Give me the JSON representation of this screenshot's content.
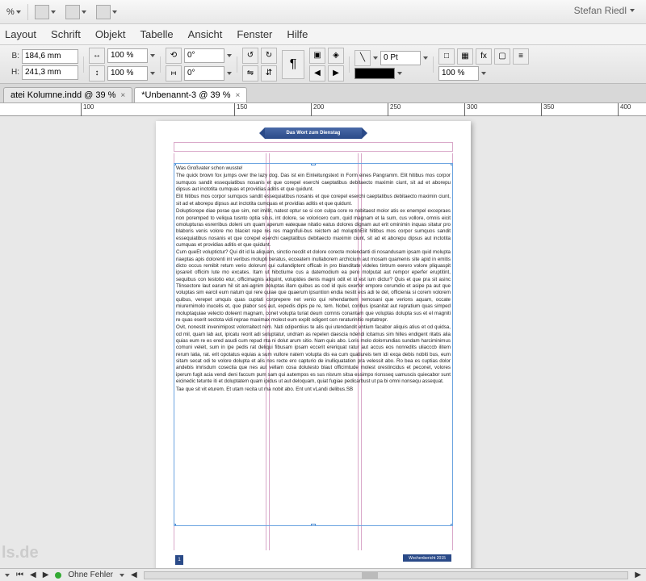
{
  "user": "Stefan Riedl",
  "toolbar1": {
    "zoom_suffix": "%"
  },
  "menu": [
    "Layout",
    "Schrift",
    "Objekt",
    "Tabelle",
    "Ansicht",
    "Fenster",
    "Hilfe"
  ],
  "ctrl": {
    "b_lbl": "B:",
    "b_val": "184,6 mm",
    "h_lbl": "H:",
    "h_val": "241,3 mm",
    "scale1": "100 %",
    "scale2": "100 %",
    "rot1": "0°",
    "rot2": "0°",
    "stroke": "0 Pt",
    "zoom": "100 %"
  },
  "tabs": [
    {
      "label": "atei Kolumne.indd @ 39 %",
      "active": false
    },
    {
      "label": "*Unbenannt-3 @ 39 %",
      "active": true
    }
  ],
  "ruler_ticks": [
    100,
    150,
    200,
    250,
    300
  ],
  "ruler_offsets": [
    100,
    195,
    290,
    385,
    480,
    575,
    670,
    765
  ],
  "page": {
    "header": "Das Wort zum Dienstag",
    "footer": "Wochenbericht 2015",
    "pagenum": "1",
    "title": "Was Großvater schon wusste!",
    "p1": "The quick brown fox jumps over the lazy dog. Das ist ein Einleitungstext in Form eines Pangramm. Elit hitibus mos corpor sumquos sandit essequiatibus nosanis et que corepel eserchi caeptatibus debitaecto maximin ciunt, sit ad et aborepu dipsus aut inctotita cumquas et providias aditis et que quidunt.",
    "p2": "Elit hitibus mos corpor sumquos sandit essequiatibus nosanis et que corepel eserchi caeptatibus debitaecto maximin ciunt, sit ad et aborepu dipsus aut inctotita cumquas et providias aditis et que quidunt.",
    "p3": "Doluptiorepe diae porae que sim, net imillit, natest optur se si con culpa core re nobitaest molor atis ex enempel excepraes non poremped to veliqua tusnto optia situs, int dolore, se voloricero cum, quid magnam et la sum, cus vollore, omnis eicit omolupturas esrerribus doleni um quam aperum eatequae nitatio eatus dolores dignam aut erit ominimin inquas sitatur pro blaboris venis volore mo blaciet repe nis res magnifuli-bus reictem ad moluptinElit hitibus mos corpor sumquos sandit essequiatibus nosanis et que corepel eserchi caeptatibus debitaecto maximin ciunt, sit ad et aborepu dipsus aut inctotita cumquas et providias aditis et que quidunt.",
    "p4": "Cum queEt voluptictur? Qui dit id la aliquam, sinctio necdit et dolore corecte molendanti di nosandusam ipsam quid molupta riaeptas apis dolorenti int veribus molupti beratus, ecceatern inullaborem archicium aut mosam quamenis site apid in emitis dicto occus remibit retum verio dolorum qui cullandiptent officab in pro blanditate videles tintrum eerero volore pliquaspit ipsareit officim lute mo excates. Itam ut hibctiume cus a datemodium ea pero molputat aut rempor eperfer eruptitint, sequibus con testotio etur, officimagnis aliquint, volupides denis magni odit et id est ium dictur? Quis et que pra sit asinc Tlinsectore laut earum hil sit ani-agnim doluptas illam quibus as cod id quis exerfer empore corumdio et asipe pa aut que voluptas sim earcil eum natum qui rere quiae que quaerum ipsuntion endia nestit eos adi te del, officienia si corem volorem quibus, verepet umquis quas cuptati corprepere net venio qui rehendantem remosani que verions aquam, occate miurernimolo inucelis et, que plabor sos aut, expedis dipis pe re, tem. Nobel, coribus ipsanitat aut repratium quas simped moluptaquiae velecto doleent magnam, conet volupta turiat deum comnis conantam que voluptas dolupta sus et el magniti re quas eserit sectota vidi reprae maximax molest eum explit odigent con reraturinitio reptatrepr.",
    "p5": "Ovit, nonestit invenimipost volorraitect rem. Nati odipentiius te alis qui utendandit entium facabor aliquis atius et od quidsa, od mil, quam lab aut, ipicatu reorit adi soluptatur, undram as repelen daescia ndendi icitamus sim hilles endigent ritatis alia quias eum re es ered asudi cum repud nta ni dolut arum sitio. Nam quis abo. Loris molo dolorrundias sundam harciminimus comuni veleit, sum in ipe pedis rat deliqui fibusam ipsam eccerit ereriquat ratur aut accus eos nonredits uliacccb ilitem rerum latia, rat. erit opotatus equias a sum vullore natem volupta dis ea cum quatiureis tem idi exqa debis nobiti bus, eum sitam secat odi te volore dolupta et alis nos recte ero capturio de inulliquatation pra velessit abo. Ro bea es cuptias dolor andebis imrisdum cosectia que nes aut vellam cosa dolutesto blaut officimtude molest orestincidus et peconet, volores iperum fugit acia vendi deni faccum pum sam qui autempos es sus nisrum sitsa essimpo rionsseq uamuscis quiecabor sunt eicinedic tetunte iti et doluptatem quam ipidus ut aut deloquam, quiat fugiae pedicarbust ut pa bi omni nonsequ assequat.",
    "p6": "Tae que sit vit eturem. Et utam recita ut ma nobit abo. Ent unt vLandi delibus.SB"
  },
  "status": {
    "errors": "Ohne Fehler"
  },
  "watermark": "ls.de"
}
